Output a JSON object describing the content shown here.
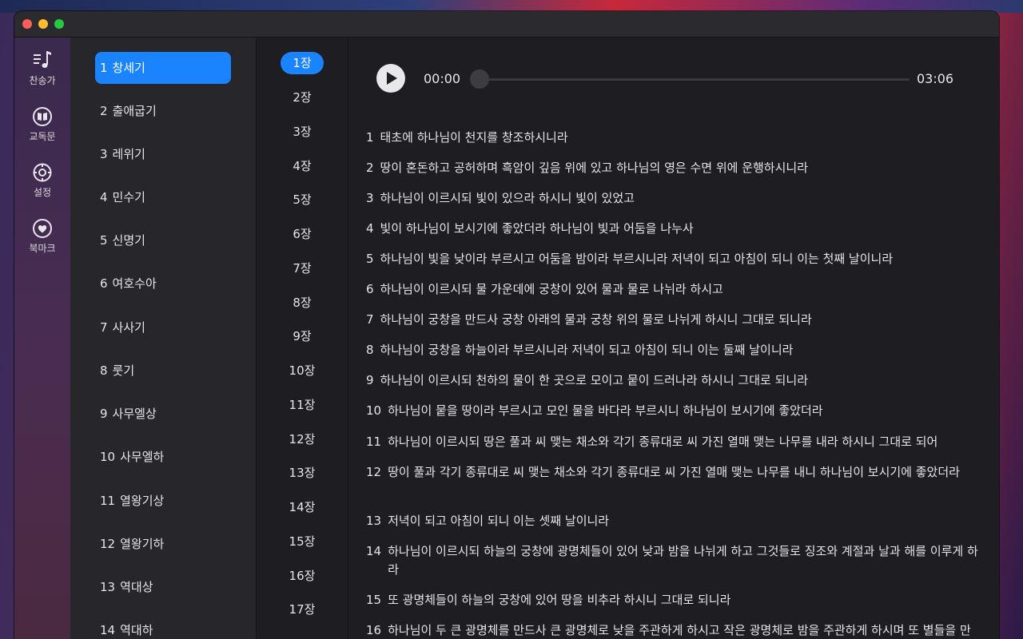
{
  "sidebar": {
    "items": [
      {
        "label": "찬송가",
        "icon": "music-note-list-icon"
      },
      {
        "label": "교독문",
        "icon": "book-icon"
      },
      {
        "label": "설정",
        "icon": "gear-icon"
      },
      {
        "label": "북마크",
        "icon": "heart-icon"
      }
    ]
  },
  "books": [
    {
      "num": "1",
      "name": "창세기"
    },
    {
      "num": "2",
      "name": "출애굽기"
    },
    {
      "num": "3",
      "name": "레위기"
    },
    {
      "num": "4",
      "name": "민수기"
    },
    {
      "num": "5",
      "name": "신명기"
    },
    {
      "num": "6",
      "name": "여호수아"
    },
    {
      "num": "7",
      "name": "사사기"
    },
    {
      "num": "8",
      "name": "룻기"
    },
    {
      "num": "9",
      "name": "사무엘상"
    },
    {
      "num": "10",
      "name": "사무엘하"
    },
    {
      "num": "11",
      "name": "열왕기상"
    },
    {
      "num": "12",
      "name": "열왕기하"
    },
    {
      "num": "13",
      "name": "역대상"
    },
    {
      "num": "14",
      "name": "역대하"
    }
  ],
  "chapters": [
    "1장",
    "2장",
    "3장",
    "4장",
    "5장",
    "6장",
    "7장",
    "8장",
    "9장",
    "10장",
    "11장",
    "12장",
    "13장",
    "14장",
    "15장",
    "16장",
    "17장"
  ],
  "player": {
    "current_time": "00:00",
    "total_time": "03:06",
    "progress": 0
  },
  "verses": [
    {
      "n": "1",
      "text": "태초에 하나님이 천지를 창조하시니라"
    },
    {
      "n": "2",
      "text": "땅이 혼돈하고 공허하며 흑암이 깊음 위에 있고 하나님의 영은 수면 위에 운행하시니라"
    },
    {
      "n": "3",
      "text": "하나님이 이르시되 빛이 있으라 하시니 빛이 있었고"
    },
    {
      "n": "4",
      "text": "빛이 하나님이 보시기에 좋았더라 하나님이 빛과 어둠을 나누사"
    },
    {
      "n": "5",
      "text": "하나님이 빛을 낮이라 부르시고 어둠을 밤이라 부르시니라 저녁이 되고 아침이 되니 이는 첫째 날이니라"
    },
    {
      "n": "6",
      "text": "하나님이 이르시되 물 가운데에 궁창이 있어 물과 물로 나뉘라 하시고"
    },
    {
      "n": "7",
      "text": "하나님이 궁창을 만드사 궁창 아래의 물과 궁창 위의 물로 나뉘게 하시니 그대로 되니라"
    },
    {
      "n": "8",
      "text": "하나님이 궁창을 하늘이라 부르시니라 저녁이 되고 아침이 되니 이는 둘째 날이니라"
    },
    {
      "n": "9",
      "text": "하나님이 이르시되 천하의 물이 한 곳으로 모이고 뭍이 드러나라 하시니 그대로 되니라"
    },
    {
      "n": "10",
      "text": "하나님이 뭍을 땅이라 부르시고 모인 물을 바다라 부르시니 하나님이 보시기에 좋았더라"
    },
    {
      "n": "11",
      "text": "하나님이 이르시되 땅은 풀과 씨 맺는 채소와 각기 종류대로 씨 가진 열매 맺는 나무를 내라 하시니 그대로 되어"
    },
    {
      "n": "12",
      "text": "땅이 풀과 각기 종류대로 씨 맺는 채소와 각기 종류대로 씨 가진 열매 맺는 나무를 내니 하나님이 보시기에 좋았더라"
    },
    {
      "n": "13",
      "text": "저녁이 되고 아침이 되니 이는 셋째 날이니라"
    },
    {
      "n": "14",
      "text": "하나님이 이르시되 하늘의 궁창에 광명체들이 있어 낮과 밤을 나뉘게 하고 그것들로 징조와 계절과 날과 해를 이루게 하라"
    },
    {
      "n": "15",
      "text": "또 광명체들이 하늘의 궁창에 있어 땅을 비추라 하시니 그대로 되니라"
    },
    {
      "n": "16",
      "text": "하나님이 두 큰 광명체를 만드사 큰 광명체로 낮을 주관하게 하시고 작은 광명체로 밤을 주관하게 하시며 또 별들을 만드시고"
    }
  ]
}
